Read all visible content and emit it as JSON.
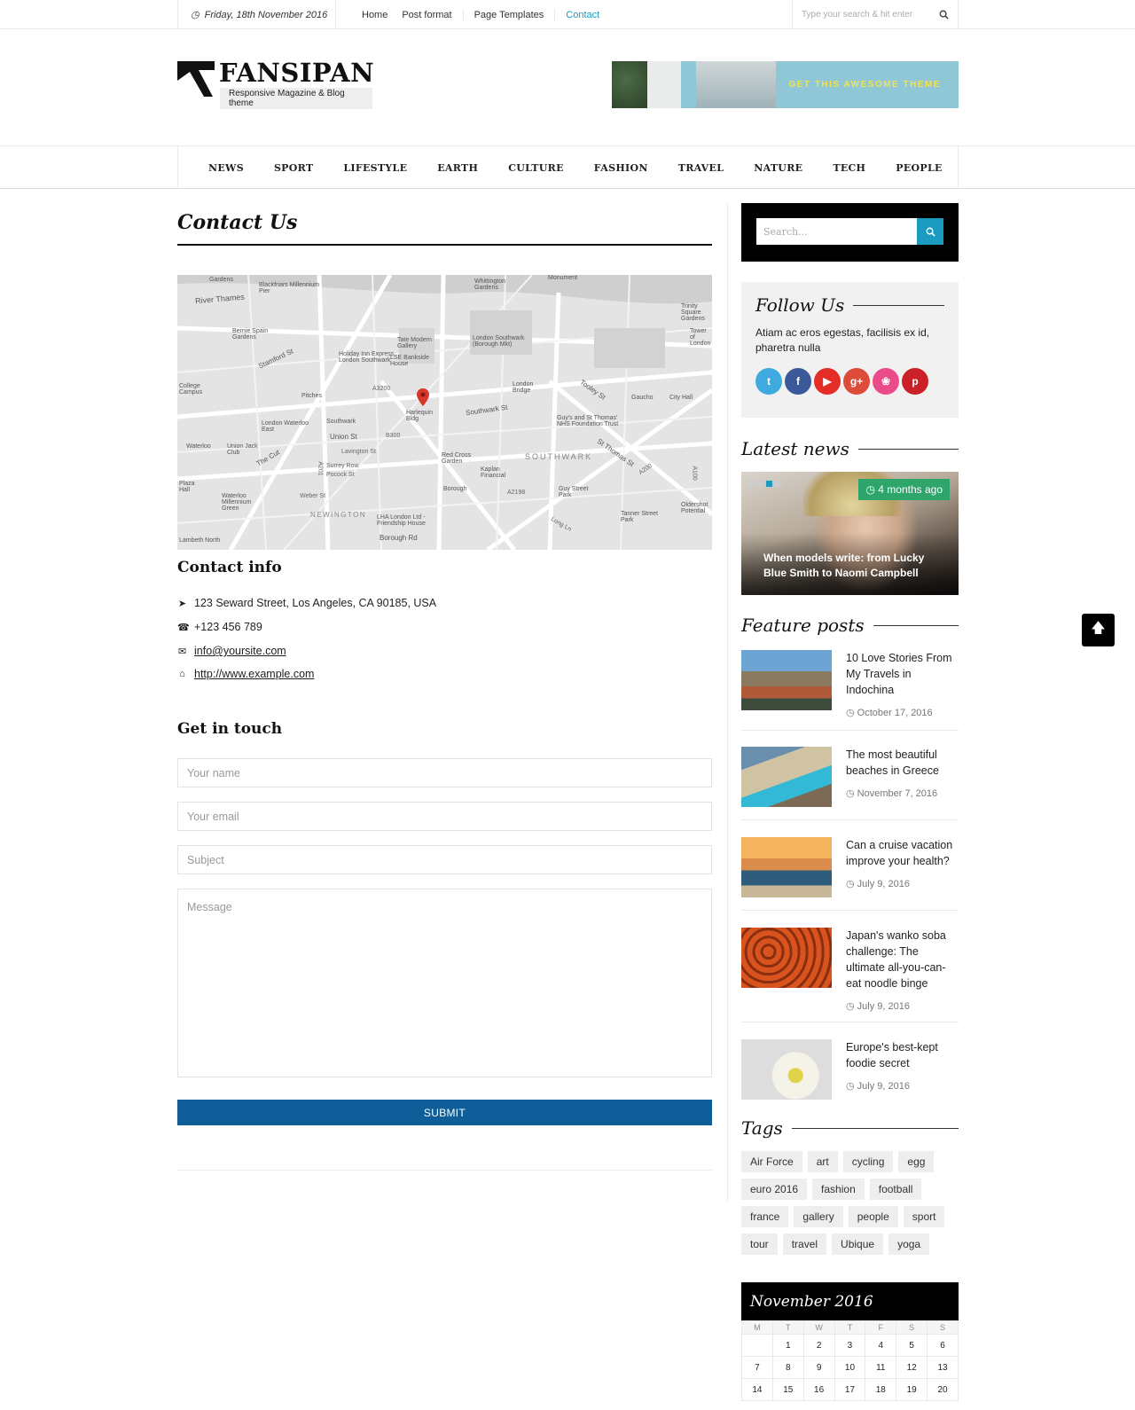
{
  "topbar": {
    "date": "Friday, 18th November 2016",
    "menu": [
      "Home",
      "Post format",
      "Page Templates",
      "Contact"
    ],
    "active_menu": "Contact",
    "search_placeholder": "Type your search & hit enter"
  },
  "header": {
    "logo_name": "FANSIPAN",
    "logo_tagline": "Responsive Magazine & Blog theme",
    "banner_text": "GET THIS AWESOME THEME"
  },
  "nav": [
    "NEWS",
    "SPORT",
    "LIFESTYLE",
    "EARTH",
    "CULTURE",
    "FASHION",
    "TRAVEL",
    "NATURE",
    "TECH",
    "PEOPLE"
  ],
  "main": {
    "title": "Contact Us",
    "map_labels": [
      "River Thames",
      "Blackfriars Millennium Pier",
      "Whittington Gardens",
      "Monument",
      "Bernie Spain Gardens",
      "Stamford St",
      "Tate Modern Gallery",
      "Holiday Inn Express London Southwark",
      "LSE Bankside House",
      "London Southwark (Borough Mkt)",
      "London Bridge",
      "Tooley St",
      "Gaucho",
      "City Hall",
      "Pitches",
      "Harlequin Bldg",
      "Southwark St",
      "Guy's and St Thomas' NHS Foundation Trust",
      "London Waterloo East",
      "Southwark",
      "Union St",
      "SOUTHWARK",
      "Waterloo",
      "Union Jack Club",
      "The Cut",
      "Red Cross Garden",
      "Kaplan Financial",
      "St Thomas St",
      "Borough",
      "Guy Street Park",
      "Tanner Street Park",
      "Waterloo Millennium Green",
      "NEWINGTON",
      "LHA London Ltd - Friendship House",
      "Borough Rd",
      "Lambeth North",
      "College Campus",
      "Plaza Hall",
      "A3200",
      "A201",
      "B300",
      "A2198",
      "A200",
      "A100",
      "Long Ln",
      "Weber St",
      "Surrey Row",
      "Pocock St",
      "Lavington St",
      "Trinity Square Gardens",
      "Tower of London",
      "Gardens",
      "Oldershot Potential"
    ],
    "contact_info_heading": "Contact info",
    "address": "123 Seward Street, Los Angeles, CA 90185, USA",
    "phone": "+123 456 789",
    "email": "info@yoursite.com",
    "website": "http://www.example.com",
    "get_in_touch_heading": "Get in touch",
    "form": {
      "name_placeholder": "Your name",
      "email_placeholder": "Your email",
      "subject_placeholder": "Subject",
      "message_placeholder": "Message",
      "submit_label": "SUBMIT"
    }
  },
  "sidebar": {
    "search_placeholder": "Search...",
    "follow": {
      "title": "Follow Us",
      "text": "Atiam ac eros egestas, facilisis ex id, pharetra nulla",
      "icons": [
        "twitter-icon",
        "facebook-icon",
        "youtube-icon",
        "google-plus-icon",
        "dribbble-icon",
        "pinterest-icon"
      ]
    },
    "latest_news": {
      "title": "Latest news",
      "badge": "4 months ago",
      "caption": "When models write: from Lucky Blue Smith to Naomi Campbell"
    },
    "feature_posts": {
      "title": "Feature posts",
      "items": [
        {
          "title": "10 Love Stories From My Travels in Indochina",
          "date": "October 17, 2016"
        },
        {
          "title": "The most beautiful beaches in Greece",
          "date": "November 7, 2016"
        },
        {
          "title": "Can a cruise vacation improve your health?",
          "date": "July 9, 2016"
        },
        {
          "title": "Japan's wanko soba challenge: The ultimate all-you-can-eat noodle binge",
          "date": "July 9, 2016"
        },
        {
          "title": "Europe's best-kept foodie secret",
          "date": "July 9, 2016"
        }
      ]
    },
    "tags": {
      "title": "Tags",
      "items": [
        "Air Force",
        "art",
        "cycling",
        "egg",
        "euro 2016",
        "fashion",
        "football",
        "france",
        "gallery",
        "people",
        "sport",
        "tour",
        "travel",
        "Ubique",
        "yoga"
      ]
    },
    "calendar": {
      "title": "November 2016",
      "weekdays": [
        "M",
        "T",
        "W",
        "T",
        "F",
        "S",
        "S"
      ],
      "weeks": [
        [
          "",
          "1",
          "2",
          "3",
          "4",
          "5",
          "6"
        ],
        [
          "7",
          "8",
          "9",
          "10",
          "11",
          "12",
          "13"
        ],
        [
          "14",
          "15",
          "16",
          "17",
          "18",
          "19",
          "20"
        ]
      ]
    }
  },
  "colors": {
    "accent": "#1a9bbf",
    "submit": "#105e99",
    "badge": "#2ea56b",
    "social": [
      "#3eaadf",
      "#3b5998",
      "#e52d27",
      "#dd4b39",
      "#ea4c89",
      "#cb2027"
    ]
  }
}
